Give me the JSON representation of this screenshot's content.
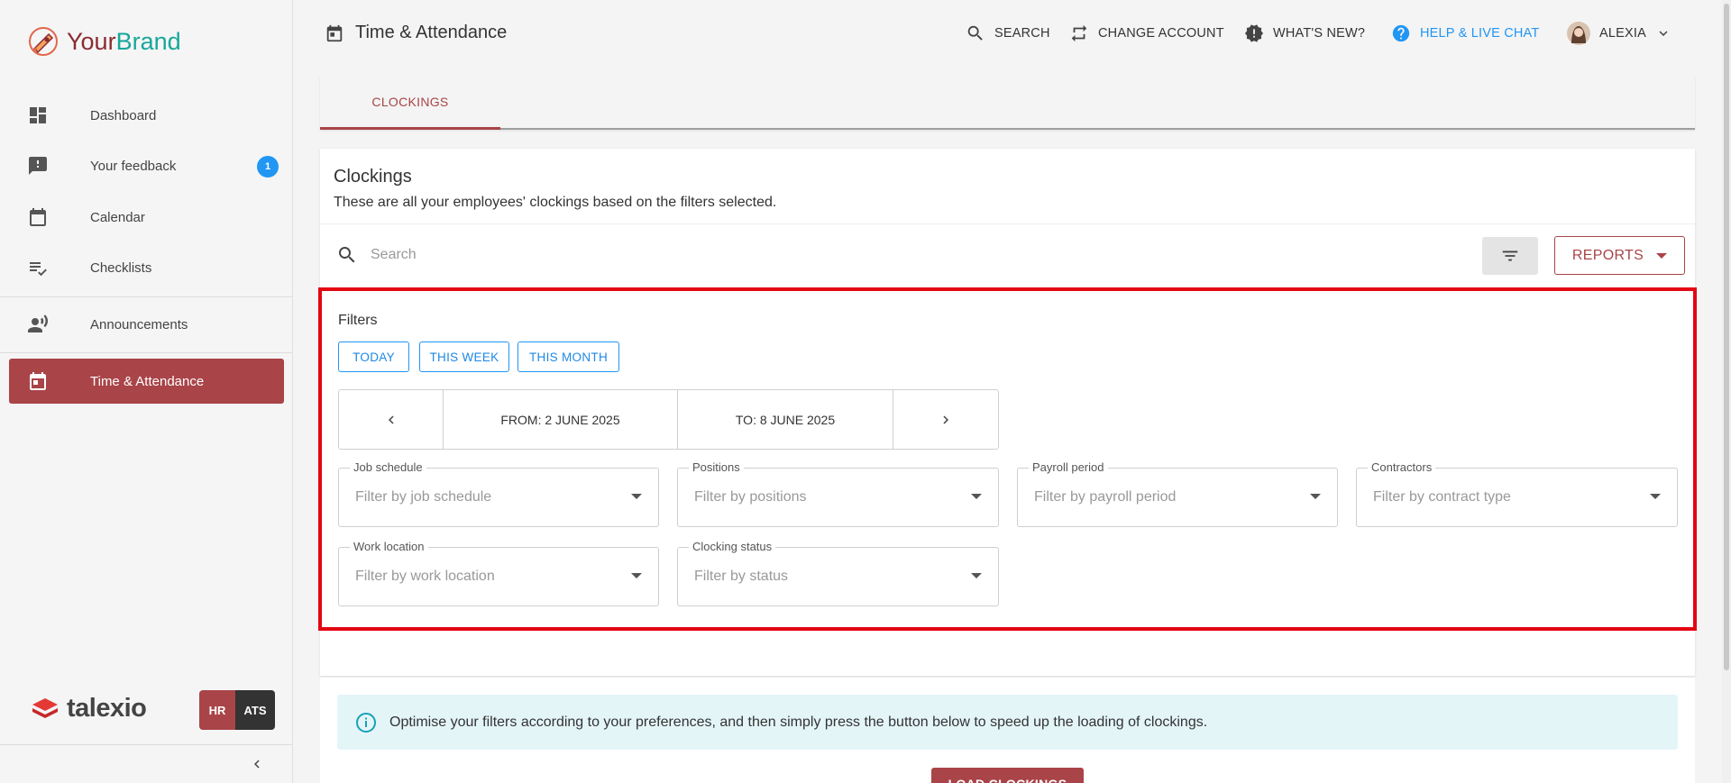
{
  "brand": {
    "part1": "Your",
    "part2": "Brand"
  },
  "sidebar": {
    "items": [
      {
        "label": "Dashboard",
        "icon": "dashboard-icon"
      },
      {
        "label": "Your feedback",
        "icon": "feedback-icon",
        "badge": "1"
      },
      {
        "label": "Calendar",
        "icon": "calendar-icon"
      },
      {
        "label": "Checklists",
        "icon": "checklist-icon"
      },
      {
        "label": "Announcements",
        "icon": "announcement-icon"
      },
      {
        "label": "Time & Attendance",
        "icon": "time-attendance-icon",
        "active": true
      }
    ],
    "footer_logo": "talexio",
    "hr_label": "HR",
    "ats_label": "ATS"
  },
  "header": {
    "title": "Time & Attendance",
    "search_label": "SEARCH",
    "change_account_label": "CHANGE ACCOUNT",
    "whats_new_label": "WHAT'S NEW?",
    "help_label": "HELP & LIVE CHAT",
    "user_name": "ALEXIA"
  },
  "tabs": [
    {
      "label": "CLOCKINGS"
    }
  ],
  "main": {
    "title": "Clockings",
    "subtitle": "These are all your employees' clockings based on the filters selected.",
    "search_placeholder": "Search",
    "reports_label": "REPORTS"
  },
  "filters": {
    "title": "Filters",
    "quick": [
      "TODAY",
      "THIS WEEK",
      "THIS MONTH"
    ],
    "from_label": "FROM: 2 JUNE 2025",
    "to_label": "TO: 8 JUNE 2025",
    "fields": [
      {
        "label": "Job schedule",
        "placeholder": "Filter by job schedule"
      },
      {
        "label": "Positions",
        "placeholder": "Filter by positions"
      },
      {
        "label": "Payroll period",
        "placeholder": "Filter by payroll period"
      },
      {
        "label": "Contractors",
        "placeholder": "Filter by contract type"
      },
      {
        "label": "Work location",
        "placeholder": "Filter by work location"
      },
      {
        "label": "Clocking status",
        "placeholder": "Filter by status"
      }
    ]
  },
  "info": {
    "text": "Optimise your filters according to your preferences, and then simply press the button below to speed up the loading of clockings.",
    "load_label": "LOAD CLOCKINGS"
  },
  "colors": {
    "accent": "#a94448",
    "link": "#2196f3",
    "highlight": "#e30613",
    "info_bg": "#e4f5f8"
  }
}
